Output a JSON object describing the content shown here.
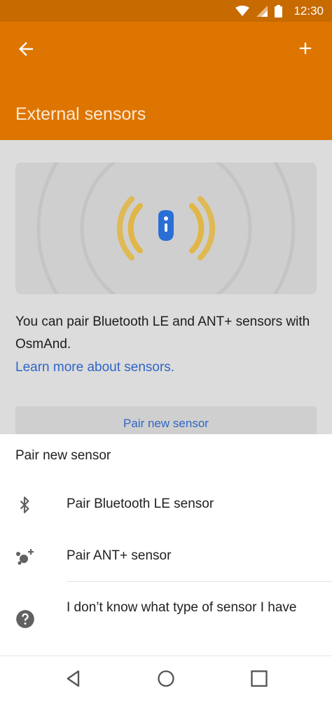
{
  "status": {
    "time": "12:30"
  },
  "appbar": {
    "title": "External sensors"
  },
  "content": {
    "description": "You can pair Bluetooth LE and ANT+ sensors with OsmAnd.",
    "learn_more": "Learn more about sensors.",
    "pair_button": "Pair new sensor"
  },
  "sheet": {
    "title": "Pair new sensor",
    "options": [
      {
        "label": "Pair Bluetooth LE sensor",
        "icon": "bluetooth-icon"
      },
      {
        "label": "Pair ANT+ sensor",
        "icon": "ant-plus-icon"
      },
      {
        "label": "I don’t know what type of sensor I have",
        "icon": "help-icon"
      }
    ]
  },
  "colors": {
    "appbar": "#de7500",
    "statusbar": "#c76a00",
    "accent_link": "#2f66c6",
    "signal_yellow": "#e0b646",
    "sensor_blue": "#2a6fd6"
  }
}
